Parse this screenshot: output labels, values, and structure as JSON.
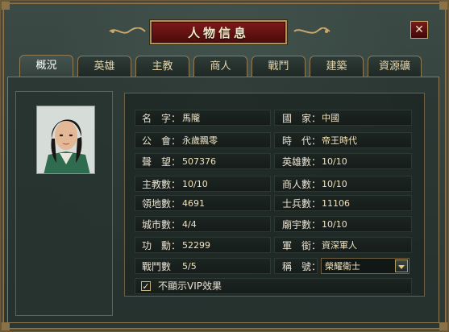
{
  "window": {
    "title": "人物信息",
    "close_label": "✕"
  },
  "tabs": [
    {
      "label": "概況",
      "active": true
    },
    {
      "label": "英雄"
    },
    {
      "label": "主教"
    },
    {
      "label": "商人"
    },
    {
      "label": "戰鬥"
    },
    {
      "label": "建築"
    },
    {
      "label": "資源礦"
    }
  ],
  "info": {
    "name_label": "名　字：",
    "name_value": "馬隴",
    "country_label": "國　家：",
    "country_value": "中國",
    "guild_label": "公　會：",
    "guild_value": "永歲飄零",
    "era_label": "時　代：",
    "era_value": "帝王時代",
    "fame_label": "聲　望：",
    "fame_value": "507376",
    "hero_count_label": "英雄數：",
    "hero_count_value": "10/10",
    "bishop_count_label": "主教數：",
    "bishop_count_value": "10/10",
    "merchant_count_label": "商人數：",
    "merchant_count_value": "10/10",
    "territory_label": "領地數：",
    "territory_value": "4691",
    "soldiers_label": "士兵數：",
    "soldiers_value": "11106",
    "city_label": "城市數：",
    "city_value": "4/4",
    "temple_label": "廟宇數：",
    "temple_value": "10/10",
    "merit_label": "功　勳：",
    "merit_value": "52299",
    "rank_label": "軍　銜：",
    "rank_value": "資深軍人",
    "battle_label": "戰鬥數",
    "battle_value": "5/5",
    "title_label": "稱　號：",
    "title_value": "榮耀衛士"
  },
  "vip": {
    "label": "不顯示VIP效果",
    "checked": true,
    "check_glyph": "✓"
  },
  "colors": {
    "accent_gold": "#b3924f",
    "title_red": "#7c1a1a"
  }
}
